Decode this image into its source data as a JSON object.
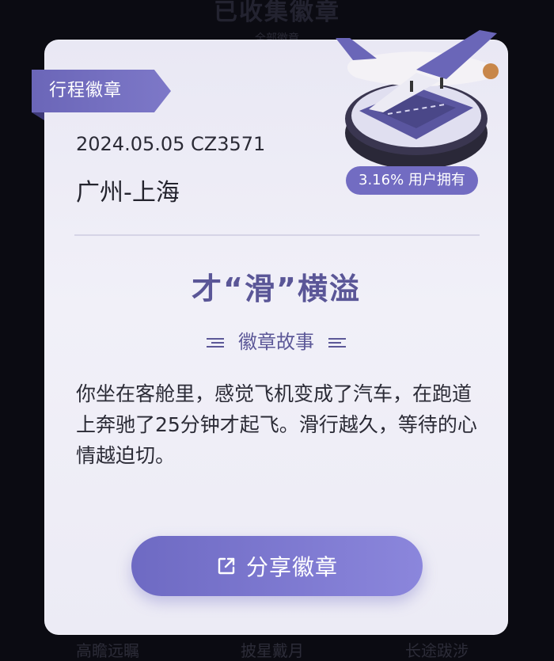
{
  "background": {
    "header_title": "已收集徽章",
    "header_sub": "全部徽章",
    "footer_items": [
      "高瞻远瞩",
      "披星戴月",
      "长途跋涉"
    ]
  },
  "card": {
    "ribbon_label": "行程徽章",
    "flight_info": "2024.05.05 CZ3571",
    "route": "广州-上海",
    "owner_rate": "3.16% 用户拥有",
    "badge_title": "才“滑”横溢",
    "story_label": "徽章故事",
    "story_text": "你坐在客舱里，感觉飞机变成了汽车，在跑道上奔驰了25分钟才起飞。滑行越久，等待的心情越迫切。",
    "share_label": "分享徽章"
  },
  "icons": {
    "share": "share-icon",
    "badge": "airplane-badge-icon"
  },
  "colors": {
    "accent": "#726cc2",
    "ribbon": "#6b66b8",
    "title": "#5a5697",
    "card_bg": "#eeedf6"
  }
}
